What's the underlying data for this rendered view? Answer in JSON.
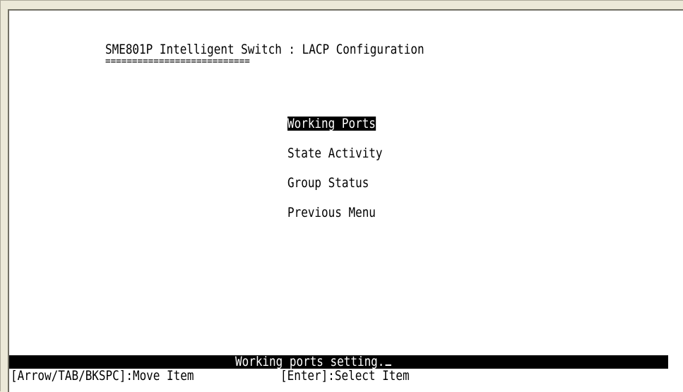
{
  "screen": {
    "title": "SME801P Intelligent Switch : LACP Configuration",
    "title_underline": "==========================="
  },
  "menu": {
    "items": [
      {
        "label": "Working Ports",
        "selected": true
      },
      {
        "label": "State Activity",
        "selected": false
      },
      {
        "label": "Group Status",
        "selected": false
      },
      {
        "label": "Previous Menu",
        "selected": false
      }
    ]
  },
  "status_bar": {
    "message": "Working ports setting."
  },
  "key_hints": {
    "move": "[Arrow/TAB/BKSPC]:Move Item",
    "select": "[Enter]:Select Item"
  },
  "colors": {
    "background": "#ffffff",
    "text": "#000000",
    "highlight_bg": "#000000",
    "highlight_fg": "#ffffff",
    "window_frame": "#ece9d8"
  }
}
